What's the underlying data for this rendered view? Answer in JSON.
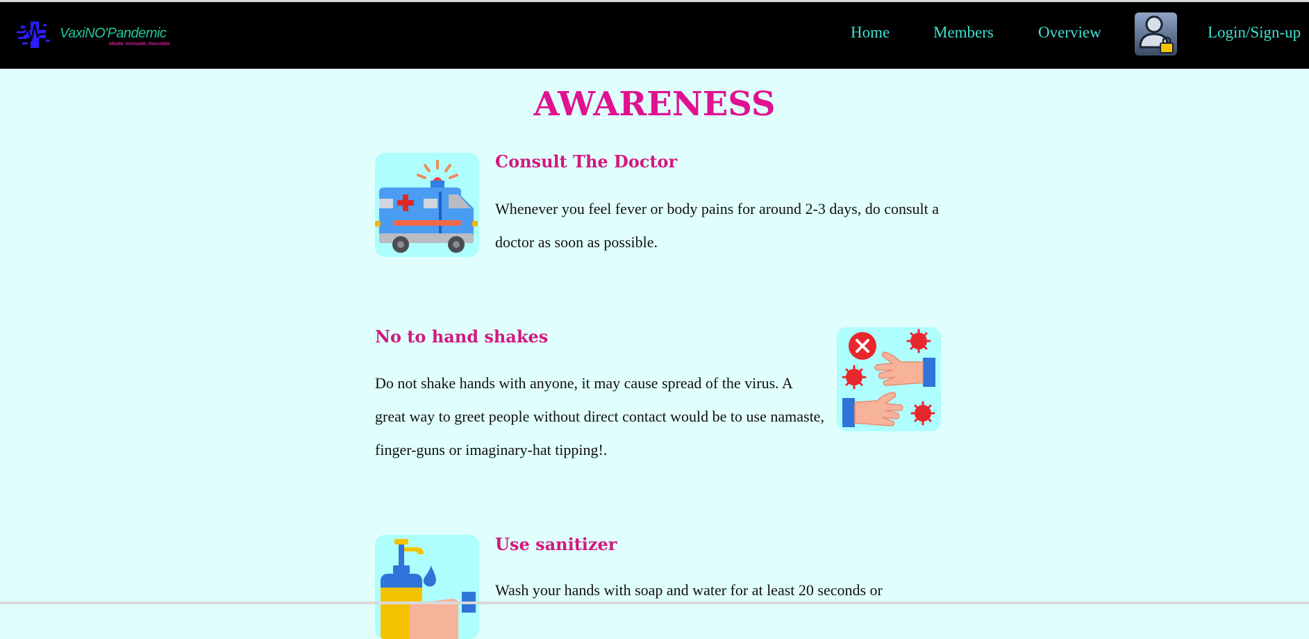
{
  "brand": {
    "name": "VaxiNO'Pandemic",
    "tagline": "Ideate. Innovate. Inoculate"
  },
  "nav": {
    "home": "Home",
    "members": "Members",
    "overview": "Overview",
    "login": "Login/Sign-up"
  },
  "page": {
    "title": "AWARENESS"
  },
  "cards": [
    {
      "title": "Consult The Doctor",
      "text": "Whenever you feel fever or body pains for around 2-3 days, do consult a doctor as soon as possible.",
      "icon": "ambulance-icon"
    },
    {
      "title": "No to hand shakes",
      "text": "Do not shake hands with anyone, it may cause spread of the virus. A great way to greet people without direct contact would be to use namaste, finger-guns or imaginary-hat tipping!.",
      "icon": "no-handshake-icon"
    },
    {
      "title": "Use sanitizer",
      "text": "Wash your hands with soap and water for at least 20 seconds or",
      "icon": "sanitizer-icon"
    }
  ],
  "colors": {
    "nav_bg": "#000000",
    "nav_link": "#40e0d0",
    "page_bg": "#e0fffc",
    "title": "#e0128f",
    "card_title": "#d2187f",
    "icon_bg": "#aefefd"
  }
}
